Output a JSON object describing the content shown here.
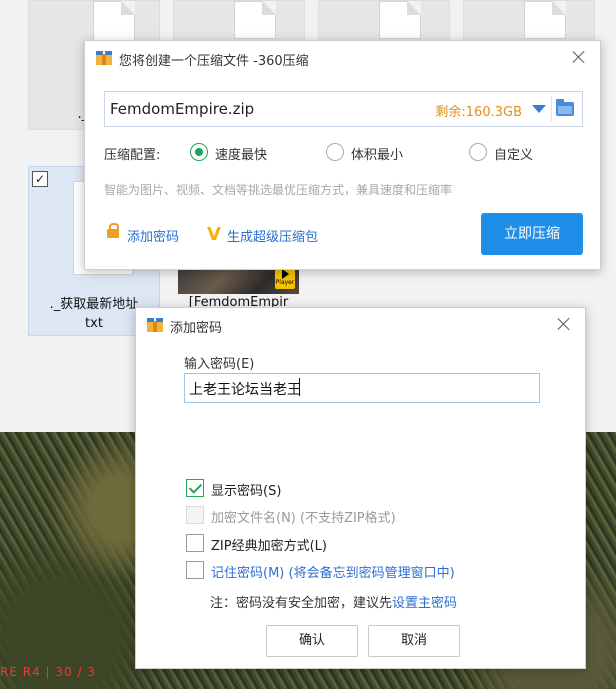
{
  "explorer": {
    "files": [
      {
        "name": "._.DS"
      },
      {
        "name": "._获取最新地址",
        "name_line2": "txt",
        "checked": true
      },
      {
        "name": "[FemdomEmpir"
      }
    ],
    "player_badge": "Player"
  },
  "video": {
    "caption": "RE R4 | 30 / 3"
  },
  "compress_dialog": {
    "title": "您将创建一个压缩文件 -360压缩",
    "filename": "FemdomEmpire.zip",
    "free_space": "剩余:160.3GB",
    "config_label": "压缩配置:",
    "options": [
      {
        "label": "速度最快",
        "selected": true
      },
      {
        "label": "体积最小",
        "selected": false
      },
      {
        "label": "自定义",
        "selected": false
      }
    ],
    "hint": "智能为图片、视频、文档等挑选最优压缩方式，兼具速度和压缩率",
    "add_password": "添加密码",
    "super_pack": "生成超级压缩包",
    "compress_now": "立即压缩",
    "icons": {
      "title": "app-box-icon",
      "browse": "folder-icon",
      "dropdown": "chevron-down-icon",
      "password": "lock-icon",
      "super": "v-icon"
    },
    "accent": "#1e8ee8"
  },
  "password_dialog": {
    "title": "添加密码",
    "input_label": "输入密码(E)",
    "input_value": "上老王论坛当老王",
    "checks": [
      {
        "label": "显示密码(S)",
        "checked": true,
        "disabled": false
      },
      {
        "label": "加密文件名(N) (不支持ZIP格式)",
        "checked": false,
        "disabled": true
      },
      {
        "label": "ZIP经典加密方式(L)",
        "checked": false,
        "disabled": false
      },
      {
        "label": "记住密码(M) (将会备忘到密码管理窗口中)",
        "checked": false,
        "disabled": false
      }
    ],
    "note_prefix": "注：密码没有安全加密，建议先",
    "note_link": "设置主密码",
    "ok": "确认",
    "cancel": "取消"
  }
}
